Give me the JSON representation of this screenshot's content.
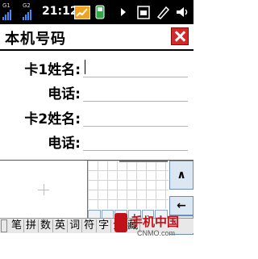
{
  "status_bar": {
    "sim1_label": "G1",
    "sim2_label": "G2",
    "time": "21:12",
    "icons": [
      "signal-g1-icon",
      "signal-g2-icon",
      "trend-icon",
      "phone-icon",
      "arrow-icon",
      "sim-card-icon",
      "pen-icon",
      "volume-icon"
    ]
  },
  "title_bar": {
    "title": "本机号码",
    "close_icon": "close-icon"
  },
  "form": {
    "card1_name_label": "卡1姓名:",
    "card1_phone_label": "电话:",
    "card2_name_label": "卡2姓名:",
    "card2_phone_label": "电话:"
  },
  "input_panel": {
    "symbols": [
      ",",
      ".",
      "?",
      "!",
      ":",
      "。"
    ],
    "side_up": "∧",
    "side_back": "←",
    "side_enter": "↵"
  },
  "toolbar": {
    "items": [
      "笔",
      "拼",
      "数",
      "英",
      "词",
      "符",
      "字",
      "全",
      "藏"
    ]
  },
  "watermark": {
    "text": "手机中国",
    "url": "CNMO.com"
  },
  "colors": {
    "status_bg": "#000000",
    "signal": "#3e8ef5",
    "close": "#d72828",
    "grid": "#c7d6e3",
    "brand": "#c0101a"
  }
}
